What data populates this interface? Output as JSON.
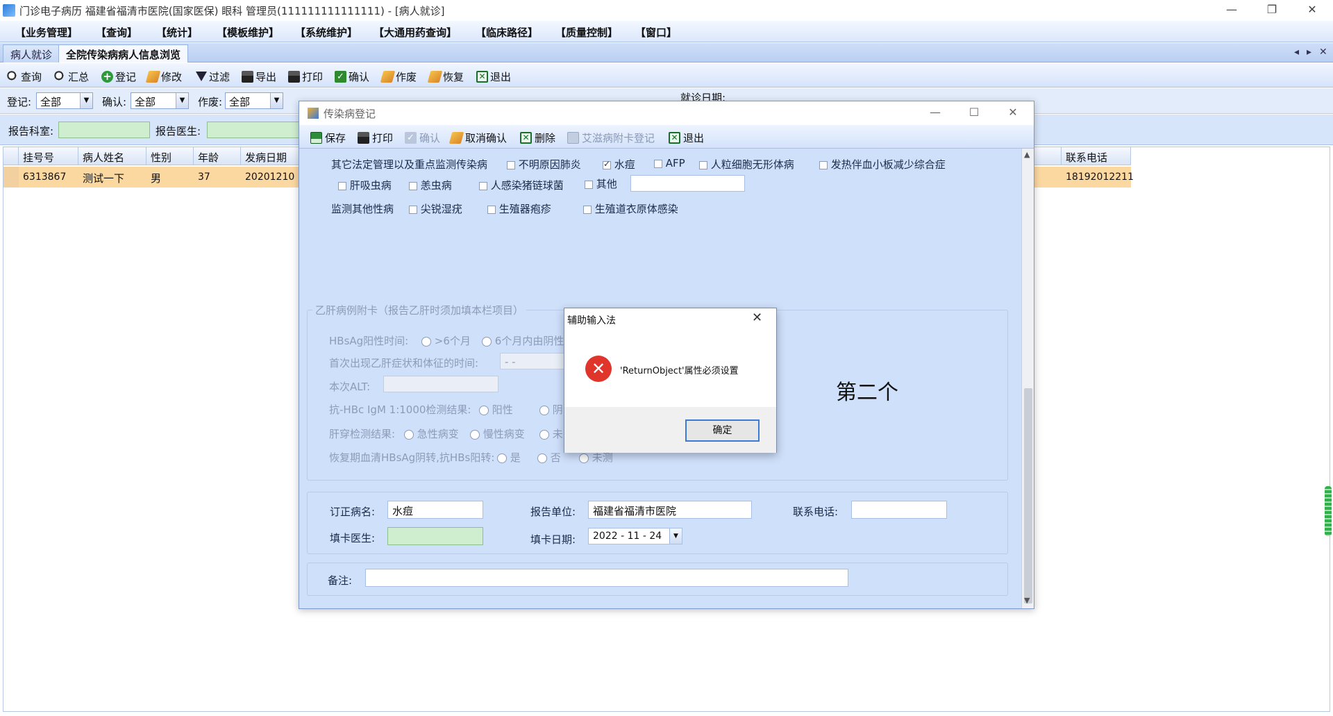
{
  "window": {
    "title": "门诊电子病历  福建省福清市医院(国家医保)  眼科  管理员(111111111111111) - [病人就诊]",
    "min": "—",
    "restore": "❐",
    "close": "✕"
  },
  "menu": [
    "【业务管理】",
    "【查询】",
    "【统计】",
    "【模板维护】",
    "【系统维护】",
    "【大通用药查询】",
    "【临床路径】",
    "【质量控制】",
    "【窗口】"
  ],
  "tabs": {
    "items": [
      "病人就诊",
      "全院传染病病人信息浏览"
    ],
    "controls": [
      "◂",
      "▸",
      "✕"
    ]
  },
  "toolbar": [
    "查询",
    "汇总",
    "登记",
    "修改",
    "过滤",
    "导出",
    "打印",
    "确认",
    "作废",
    "恢复",
    "退出"
  ],
  "filters": {
    "register_label": "登记:",
    "register_value": "全部",
    "confirm_label": "确认:",
    "confirm_value": "全部",
    "void_label": "作废:",
    "void_value": "全部",
    "visit_date_label": "就诊日期:"
  },
  "report": {
    "dept_label": "报告科室:",
    "doctor_label": "报告医生:"
  },
  "grid": {
    "headers": [
      "挂号号",
      "病人姓名",
      "性别",
      "年龄",
      "发病日期",
      "联系电话"
    ],
    "row": {
      "reg_no": "6313867",
      "name": "测试一下",
      "sex": "男",
      "age": "37",
      "onset_date": "20201210",
      "phone": "18192012211"
    }
  },
  "dialog": {
    "title": "传染病登记",
    "toolbar": [
      "保存",
      "打印",
      "确认",
      "取消确认",
      "删除",
      "艾滋病附卡登记",
      "退出"
    ],
    "other_legal_label": "其它法定管理以及重点监测传染病",
    "options_row1": [
      "不明原因肺炎",
      "水痘",
      "AFP",
      "人粒细胞无形体病",
      "发热伴血小板减少综合症"
    ],
    "options_row2": [
      "肝吸虫病",
      "恙虫病",
      "人感染猪链球菌",
      "其他"
    ],
    "std_label": "监测其他性病",
    "std_options": [
      "尖锐湿疣",
      "生殖器疱疹",
      "生殖道衣原体感染"
    ],
    "hepb": {
      "title": "乙肝病例附卡（报告乙肝时须加填本栏项目）",
      "hbsag_label": "HBsAg阳性时间:",
      "hbsag_opts": [
        ">6个月",
        "6个月内由阴性"
      ],
      "first_symptom_label": "首次出现乙肝症状和体征的时间:",
      "first_symptom_value": "  -  -",
      "alt_label": "本次ALT:",
      "anti_hbc_label": "抗-HBc IgM 1:1000检测结果:",
      "anti_hbc_opts": [
        "阳性",
        "阴"
      ],
      "liver_label": "肝穿检测结果:",
      "liver_opts": [
        "急性病变",
        "慢性病变",
        "未"
      ],
      "recovery_label": "恢复期血清HBsAg阴转,抗HBs阳转:",
      "recovery_opts": [
        "是",
        "否",
        "未测"
      ]
    },
    "correct_name_label": "订正病名:",
    "correct_name_value": "水痘",
    "report_unit_label": "报告单位:",
    "report_unit_value": "福建省福清市医院",
    "contact_label": "联系电话:",
    "fill_doctor_label": "填卡医生:",
    "fill_date_label": "填卡日期:",
    "fill_date_value": "2022 - 11 - 24",
    "remark_label": "备注:"
  },
  "msgbox": {
    "title": "辅助输入法",
    "message": "'ReturnObject'属性必须设置",
    "ok": "确定"
  },
  "annotation": "第二个",
  "icons": {
    "error": "error-icon",
    "search": "search-icon",
    "save": "save-icon",
    "printer": "printer-icon",
    "check": "check-icon",
    "exit": "exit-icon"
  }
}
